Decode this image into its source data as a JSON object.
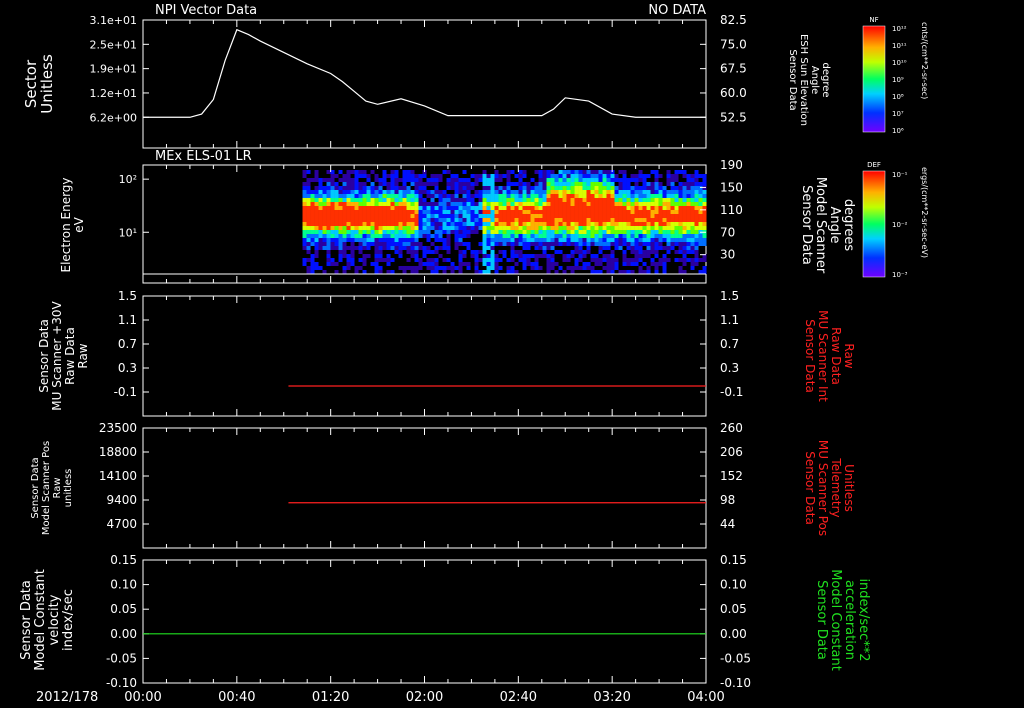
{
  "chart_data": [
    {
      "type": "line",
      "title": "NPI Vector Data",
      "status": "NO DATA",
      "ylabel": [
        "Sector",
        "Unitless"
      ],
      "y_ticks": [
        "3.1e+01",
        "2.5e+01",
        "1.9e+01",
        "1.2e+01",
        "6.2e+00"
      ],
      "y2label": [
        "Sensor Data",
        "ESH Sun Elevation",
        "Angle",
        "degree"
      ],
      "y2_ticks": [
        "82.5",
        "75.0",
        "67.5",
        "60.0",
        "52.5"
      ],
      "colorbar": {
        "label": "NF",
        "units": "cnts/(cm**2-sr-sec)",
        "ticks": [
          "10¹²",
          "10¹¹",
          "10¹⁰",
          "10⁹",
          "10⁸",
          "10⁷",
          "10⁶"
        ]
      },
      "x": [
        0,
        10,
        20,
        25,
        30,
        35,
        40,
        45,
        50,
        60,
        70,
        80,
        85,
        90,
        95,
        100,
        110,
        120,
        130,
        140,
        145,
        150,
        155,
        160,
        165,
        170,
        175,
        180,
        190,
        200,
        210,
        220,
        230,
        240
      ],
      "values": [
        52.5,
        52.5,
        52.5,
        53.5,
        58,
        70,
        79.5,
        78,
        76,
        72.5,
        69,
        66,
        63.5,
        60.5,
        57.5,
        56.5,
        58.2,
        56,
        53,
        53,
        53,
        53,
        53,
        53,
        53,
        53,
        55,
        58.5,
        57.5,
        53.5,
        52.5,
        52.5,
        52.5,
        52.5
      ]
    },
    {
      "type": "heatmap",
      "title": "MEx ELS-01 LR",
      "ylabel": [
        "Electron Energy",
        "eV"
      ],
      "y_ticks": [
        "10²",
        "10¹"
      ],
      "y2label": [
        "Sensor Data",
        "Model Scanner",
        "Angle",
        "degrees"
      ],
      "y2_ticks": [
        "190",
        "150",
        "110",
        "70",
        "30"
      ],
      "colorbar": {
        "label": "DEF",
        "units": "ergs/(cm**2-sr-sec-eV)",
        "ticks": [
          "10⁻¹",
          "10⁻²",
          "10⁻³"
        ]
      },
      "data_start_min": 68,
      "data_end_min": 240
    },
    {
      "type": "line",
      "ylabel": [
        "Sensor Data",
        "MU Scanner +30V",
        "Raw Data",
        "Raw"
      ],
      "y_ticks": [
        "1.5",
        "1.1",
        "0.7",
        "0.3",
        "-0.1"
      ],
      "y2label": [
        "Sensor Data",
        "MU Scanner Int",
        "Raw Data",
        "Raw"
      ],
      "y2_ticks": [
        "1.5",
        "1.1",
        "0.7",
        "0.3",
        "-0.1"
      ],
      "series_color": "#ff2020",
      "x_start": 62,
      "x_end": 240,
      "value": 0.0,
      "ylim": [
        -0.5,
        1.5
      ]
    },
    {
      "type": "line",
      "ylabel": [
        "Sensor Data",
        "Model Scanner Pos",
        "Raw",
        "unitless"
      ],
      "y_ticks": [
        "23500",
        "18800",
        "14100",
        "9400",
        "4700"
      ],
      "y2label": [
        "Sensor Data",
        "MU Scanner Pos",
        "Telemetry",
        "Unitless"
      ],
      "y2_ticks": [
        "260",
        "206",
        "152",
        "98",
        "44"
      ],
      "series_color": "#ff2020",
      "x_start": 62,
      "x_end": 240,
      "value": 98,
      "ylim": [
        0,
        260
      ]
    },
    {
      "type": "line",
      "ylabel": [
        "Sensor Data",
        "Model Constant",
        "velocity",
        "index/sec"
      ],
      "y_ticks": [
        "0.15",
        "0.10",
        "0.05",
        "0.00",
        "-0.05",
        "-0.10"
      ],
      "y2label": [
        "Sensor Data",
        "Model Constant",
        "acceleration",
        "index/sec**2"
      ],
      "y2_ticks": [
        "0.15",
        "0.10",
        "0.05",
        "0.00",
        "-0.05",
        "-0.10"
      ],
      "series_color": "#20e020",
      "x_start": 0,
      "x_end": 240,
      "value": 0.0,
      "ylim": [
        -0.1,
        0.15
      ]
    }
  ],
  "x_axis": {
    "date": "2012/178",
    "tick_labels": [
      "00:00",
      "00:40",
      "01:20",
      "02:00",
      "02:40",
      "03:20",
      "04:00"
    ],
    "range_min": [
      0,
      240
    ]
  },
  "colors": {
    "background": "#000000",
    "axis": "#ffffff",
    "red_label": "#ff2020",
    "green_label": "#20e020"
  }
}
